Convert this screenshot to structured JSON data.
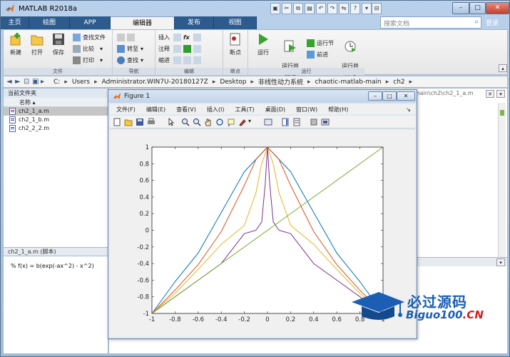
{
  "window": {
    "title": "MATLAB R2018a",
    "search_placeholder": "搜索文档",
    "login": "登录"
  },
  "tabs": [
    "主页",
    "绘图",
    "APP",
    "编辑器",
    "发布",
    "视图"
  ],
  "ribbon": {
    "file_group": {
      "label": "文件",
      "new": "新建",
      "open": "打开",
      "save": "保存",
      "find_files": "查找文件",
      "compare": "比较",
      "print": "打印"
    },
    "nav_group": {
      "label": "导航",
      "goto": "转至",
      "find": "查找"
    },
    "edit_group": {
      "label": "编辑",
      "insert": "插入",
      "comment": "注释",
      "indent": "缩进"
    },
    "breakpoint_group": {
      "label": "断点",
      "breakpoints": "断点"
    },
    "run_group": {
      "label": "运行",
      "run": "运行",
      "run_advance": "运行并\n前进",
      "run_section": "运行节",
      "advance": "前进",
      "run_time": "运行并\n计时"
    }
  },
  "address": {
    "crumbs": [
      "C:",
      "Users",
      "Administrator.WIN7U-20180127Z",
      "Desktop",
      "非线性动力系统",
      "chaotic-matlab-main",
      "ch2"
    ]
  },
  "left_panel": {
    "title": "当前文件夹",
    "column": "名称",
    "files": [
      "ch2_1_a.m",
      "ch2_1_b.m",
      "ch2_2_2.m"
    ],
    "detail_label": "ch2_1_a.m (脚本)",
    "detail_text": "% f(x) = b(exp(-ax^2) - x^2)"
  },
  "editor": {
    "tab_path": "a-main\\ch2\\ch2_1_a.m"
  },
  "figure": {
    "title": "Figure 1",
    "menu": [
      "文件(F)",
      "编辑(E)",
      "查看(V)",
      "插入(I)",
      "工具(T)",
      "桌面(D)",
      "窗口(W)",
      "帮助(H)"
    ]
  },
  "watermark": {
    "main": "必过源码",
    "sub_a": "Biguo100",
    "sub_b": ".CN"
  },
  "chart_data": {
    "type": "line",
    "title": "",
    "xlabel": "",
    "ylabel": "",
    "xlim": [
      -1,
      1
    ],
    "ylim": [
      -1,
      1
    ],
    "xticks": [
      -1,
      -0.8,
      -0.6,
      -0.4,
      -0.2,
      0,
      0.2,
      0.4,
      0.6,
      0.8,
      1
    ],
    "yticks": [
      -1,
      -0.8,
      -0.6,
      -0.4,
      -0.2,
      0,
      0.2,
      0.4,
      0.6,
      0.8,
      1
    ],
    "xtick_labels": [
      "-1",
      "-0.8",
      "-0.6",
      "-0.4",
      "-0.2",
      "0",
      "0.2",
      "0.4",
      "0.6",
      "0.8",
      "1"
    ],
    "ytick_labels": [
      "-1",
      "-0.8",
      "-0.6",
      "-0.4",
      "-0.2",
      "0",
      "0.2",
      "0.4",
      "0.6",
      "0.8",
      "1"
    ],
    "grid": false,
    "series": [
      {
        "color": "#0072bd",
        "x": [
          -1,
          -0.8,
          -0.6,
          -0.4,
          -0.2,
          0,
          0.2,
          0.4,
          0.6,
          0.8,
          1
        ],
        "y": [
          -1,
          -0.618,
          -0.275,
          0.214,
          0.705,
          1,
          0.705,
          0.214,
          -0.275,
          -0.618,
          -1
        ]
      },
      {
        "color": "#d95319",
        "x": [
          -1,
          -0.8,
          -0.6,
          -0.4,
          -0.2,
          -0.1,
          0,
          0.1,
          0.2,
          0.4,
          0.6,
          0.8,
          1
        ],
        "y": [
          -1,
          -0.72,
          -0.414,
          -0.016,
          0.54,
          0.85,
          1,
          0.85,
          0.54,
          -0.016,
          -0.414,
          -0.72,
          -1
        ]
      },
      {
        "color": "#edb120",
        "x": [
          -1,
          -0.8,
          -0.6,
          -0.4,
          -0.2,
          -0.1,
          -0.05,
          0,
          0.05,
          0.1,
          0.2,
          0.4,
          0.6,
          0.8,
          1
        ],
        "y": [
          -1,
          -0.76,
          -0.47,
          -0.17,
          0.06,
          0.45,
          0.8,
          1,
          0.8,
          0.45,
          0.06,
          -0.17,
          -0.47,
          -0.76,
          -1
        ]
      },
      {
        "color": "#7e2f8e",
        "x": [
          -1,
          -0.8,
          -0.6,
          -0.4,
          -0.2,
          -0.1,
          -0.05,
          -0.02,
          0,
          0.02,
          0.05,
          0.1,
          0.2,
          0.4,
          0.6,
          0.8,
          1
        ],
        "y": [
          -1,
          -0.8,
          -0.6,
          -0.4,
          -0.04,
          0.0,
          0.1,
          0.55,
          1,
          0.55,
          0.1,
          0.0,
          -0.04,
          -0.4,
          -0.6,
          -0.8,
          -1
        ]
      },
      {
        "color": "#77ac30",
        "x": [
          -1,
          1
        ],
        "y": [
          -1,
          1
        ]
      }
    ]
  }
}
